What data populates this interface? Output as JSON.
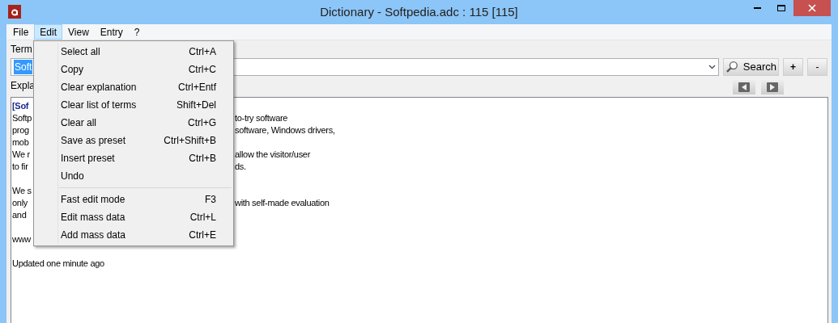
{
  "window": {
    "title": "Dictionary - Softpedia.adc : 115 [115]"
  },
  "menu_bar": [
    {
      "label": "File",
      "selected": false
    },
    {
      "label": "Edit",
      "selected": true
    },
    {
      "label": "View",
      "selected": false
    },
    {
      "label": "Entry",
      "selected": false
    },
    {
      "label": "?",
      "selected": false
    }
  ],
  "term_label": "Term",
  "term_combo": {
    "value": "Soft"
  },
  "search_button": "Search",
  "add_button": "+",
  "remove_button": "-",
  "explanation_label": "Expla",
  "explanation": [
    {
      "kind": "heading",
      "left": "[Sof"
    },
    {
      "kind": "text",
      "left": "Softp",
      "right": "to-try software"
    },
    {
      "kind": "text",
      "left": "prog",
      "right": "software, Windows drivers,"
    },
    {
      "kind": "text",
      "left": "mob"
    },
    {
      "kind": "text",
      "left": "We r",
      "right": "allow the visitor/user"
    },
    {
      "kind": "text",
      "left": "to fir",
      "right": "ds."
    },
    {
      "kind": "blank"
    },
    {
      "kind": "text",
      "left": "We s"
    },
    {
      "kind": "text",
      "left": "only",
      "right": "with self-made evaluation"
    },
    {
      "kind": "text",
      "left": "and"
    },
    {
      "kind": "blank"
    },
    {
      "kind": "text",
      "left": "www"
    },
    {
      "kind": "blank"
    },
    {
      "kind": "text",
      "left": "Updated one minute ago"
    }
  ],
  "edit_menu": [
    {
      "kind": "item",
      "label": "Select all",
      "shortcut": "Ctrl+A"
    },
    {
      "kind": "item",
      "label": "Copy",
      "shortcut": "Ctrl+C"
    },
    {
      "kind": "item",
      "label": "Clear explanation",
      "shortcut": "Ctrl+Entf"
    },
    {
      "kind": "item",
      "label": "Clear list of terms",
      "shortcut": "Shift+Del"
    },
    {
      "kind": "item",
      "label": "Clear all",
      "shortcut": "Ctrl+G"
    },
    {
      "kind": "item",
      "label": "Save as preset",
      "shortcut": "Ctrl+Shift+B"
    },
    {
      "kind": "item",
      "label": "Insert preset",
      "shortcut": "Ctrl+B"
    },
    {
      "kind": "item",
      "label": "Undo"
    },
    {
      "kind": "separator"
    },
    {
      "kind": "item",
      "label": "Fast edit mode",
      "shortcut": "F3"
    },
    {
      "kind": "item",
      "label": "Edit mass data",
      "shortcut": "Ctrl+L"
    },
    {
      "kind": "item",
      "label": "Add mass data",
      "shortcut": "Ctrl+E"
    }
  ]
}
